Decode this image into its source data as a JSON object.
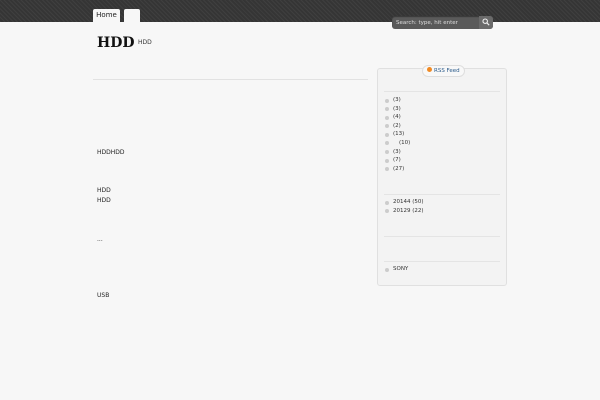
{
  "nav": {
    "tabs": [
      {
        "label": "Home"
      },
      {
        "label": ""
      }
    ]
  },
  "search": {
    "placeholder": "Search: type, hit enter"
  },
  "header": {
    "title": "HDD",
    "description": "HDD"
  },
  "content": {
    "lines": [
      "HDDHDD",
      "HDD",
      "HDD",
      "...",
      "USB"
    ]
  },
  "sidebar": {
    "rss_label": "RSS Feed",
    "categories": [
      "(3)",
      "(3)",
      "(4)",
      "(2)",
      "(13)",
      "(10)",
      "(3)",
      "(7)",
      "(27)"
    ],
    "archives": [
      "20144 (50)",
      "20129 (22)"
    ],
    "tags": [
      "SONY"
    ]
  }
}
